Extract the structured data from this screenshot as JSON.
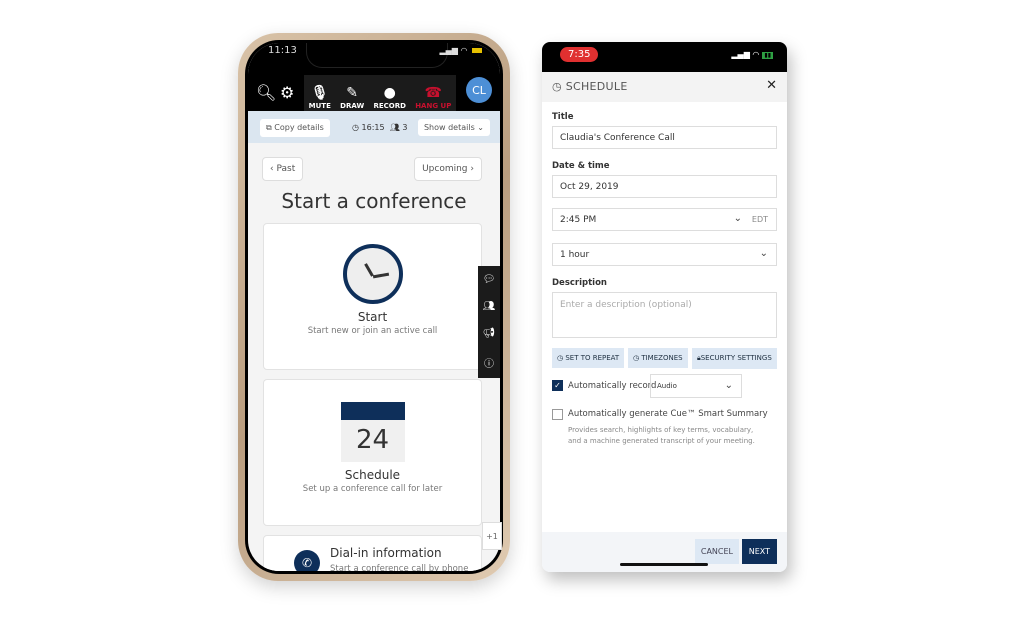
{
  "left_phone": {
    "status_time": "11:13",
    "toolbar": {
      "search_icon": "search-icon",
      "settings_icon": "gear-icon",
      "items": [
        {
          "label": "MUTE",
          "icon": "microphone-icon"
        },
        {
          "label": "DRAW",
          "icon": "pencil-icon"
        },
        {
          "label": "RECORD",
          "icon": "record-icon"
        },
        {
          "label": "HANG UP",
          "icon": "hang-up-icon"
        }
      ],
      "avatar_initials": "CL"
    },
    "info_bar": {
      "copy_details": "Copy details",
      "time": "16:15",
      "participants": "3",
      "show_details": "Show details"
    },
    "nav": {
      "past": "Past",
      "upcoming": "Upcoming"
    },
    "heading": "Start a conference",
    "cards": [
      {
        "title": "Start",
        "subtitle": "Start new or join an active call"
      },
      {
        "title": "Schedule",
        "subtitle": "Set up a conference call for later",
        "calendar_day": "24"
      },
      {
        "title": "Dial-in information",
        "subtitle": "Start a conference call by phone"
      }
    ],
    "side_tools": [
      "chat-icon",
      "participants-icon",
      "announce-icon",
      "info-icon"
    ],
    "overflow_badge": "+1"
  },
  "right_phone": {
    "status_time": "7:35",
    "header_title": "SCHEDULE",
    "title_label": "Title",
    "title_value": "Claudia's Conference Call",
    "datetime_label": "Date & time",
    "date_value": "Oct 29, 2019",
    "time_value": "2:45 PM",
    "timezone": "EDT",
    "duration_value": "1 hour",
    "description_label": "Description",
    "description_placeholder": "Enter a description (optional)",
    "options": [
      "SET TO REPEAT",
      "TIMEZONES",
      "SECURITY SETTINGS"
    ],
    "auto_record_label": "Automatically record",
    "auto_record_checked": true,
    "record_type": "Audio",
    "smart_summary_label": "Automatically generate Cue™ Smart Summary",
    "smart_summary_checked": false,
    "smart_summary_desc": "Provides search, highlights of key terms, vocabulary, and a machine generated transcript of your meeting.",
    "cancel": "CANCEL",
    "next": "NEXT"
  }
}
